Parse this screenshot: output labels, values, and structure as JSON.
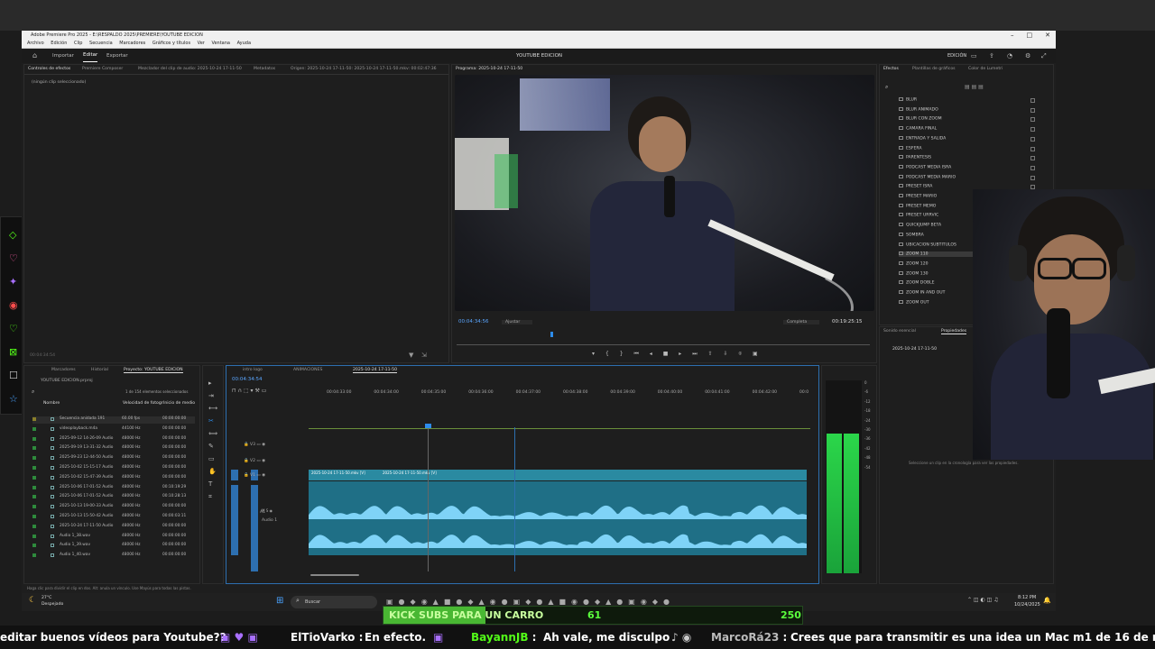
{
  "app": {
    "title": "Adobe Premiere Pro 2025 - E:\\RESPALDO 2025\\PREMIERE\\YOUTUBE EDICION",
    "menus": [
      "Archivo",
      "Edición",
      "Clip",
      "Secuencia",
      "Marcadores",
      "Gráficos y títulos",
      "Ver",
      "Ventana",
      "Ayuda"
    ],
    "workspace_tabs": [
      "Importar",
      "Editar",
      "Exportar"
    ],
    "active_tab": "Editar",
    "project_name": "YOUTUBE EDICION",
    "edition_label": "EDICIÓN"
  },
  "source_panel": {
    "tabs": [
      "Controles de efectos",
      "Premiere Composer",
      "Mezclador del clip de audio: 2025-10-24 17-11-50",
      "Metadatos",
      "Origen: 2025-10-24 17-11-50: 2025-10-24 17-11-50.mkv: 00:02:47:36"
    ],
    "message": "(ningún clip seleccionado)",
    "bottom_tc": "00:04:34:54"
  },
  "program_monitor": {
    "tab": "Programa: 2025-10-24 17-11-50",
    "timecode": "00:04:34:56",
    "fit": "Ajustar",
    "quality": "Completa",
    "duration": "00:19:25:15"
  },
  "effects_panel": {
    "tabs": [
      "Efectos",
      "Plantillas de gráficos",
      "Color de Lumetri"
    ],
    "items": [
      "BLUR",
      "BLUR ANIMADO",
      "BLUR CON ZOOM",
      "CAMARA FINAL",
      "ENTRADA Y SALIDA",
      "ESFERA",
      "PARENTESIS",
      "PODCAST MEDIA ISRA",
      "PODCAST MEDIA MARIO",
      "PRESET ISRA",
      "PRESET MARIO",
      "PRESET MEMO",
      "PRESET URRVIC",
      "QUICKJUMP BETA",
      "SOMBRA",
      "UBICACION SUBTITULOS",
      "ZOOM 110",
      "ZOOM 120",
      "ZOOM 130",
      "ZOOM DOBLE",
      "ZOOM IN AND OUT",
      "ZOOM OUT"
    ],
    "selected": "ZOOM 110"
  },
  "props_panel": {
    "tabs": [
      "Sonido esencial",
      "Propiedades"
    ],
    "clip": "2025-10-24 17-11-50",
    "hint": "Seleccione un clip en la cronología para ver las propiedades."
  },
  "project_panel": {
    "tabs": [
      "Marcadores",
      "Historial",
      "Proyecto: YOUTUBE EDICION"
    ],
    "file": "YOUTUBE EDICION.prproj",
    "count": "1 de 154 elementos seleccionados",
    "columns": [
      "Nombre",
      "Velocidad de fotogr",
      "Inicio de medio"
    ],
    "rows": [
      {
        "name": "Secuencia anidada 191",
        "fps": "60.00 fps",
        "start": "00:00:00:00",
        "color": "#8a7f2a"
      },
      {
        "name": "videoplayback.m4a",
        "fps": "44100 Hz",
        "start": "00:00:00:00",
        "color": "#2e8a3c"
      },
      {
        "name": "2025-09-12 14-26-09 Audio",
        "fps": "48000 Hz",
        "start": "00:00:00:00",
        "color": "#2e8a3c"
      },
      {
        "name": "2025-09-19 13-31-32 Audio",
        "fps": "48000 Hz",
        "start": "00:00:00:00",
        "color": "#2e8a3c"
      },
      {
        "name": "2025-09-23 12-44-50 Audio",
        "fps": "48000 Hz",
        "start": "00:00:00:00",
        "color": "#2e8a3c"
      },
      {
        "name": "2025-10-02 15-15-17 Audio",
        "fps": "48000 Hz",
        "start": "00:00:00:00",
        "color": "#2e8a3c"
      },
      {
        "name": "2025-10-02 15-47-39 Audio",
        "fps": "48000 Hz",
        "start": "00:00:00:00",
        "color": "#2e8a3c"
      },
      {
        "name": "2025-10-06 17-01-52 Audio",
        "fps": "48000 Hz",
        "start": "00:10:19:29",
        "color": "#2e8a3c"
      },
      {
        "name": "2025-10-06 17-01-52 Audio",
        "fps": "48000 Hz",
        "start": "00:10:28:13",
        "color": "#2e8a3c"
      },
      {
        "name": "2025-10-13 19-00-33 Audio",
        "fps": "48000 Hz",
        "start": "00:00:00:00",
        "color": "#2e8a3c"
      },
      {
        "name": "2025-10-13 15-50-42 Audio",
        "fps": "48000 Hz",
        "start": "00:00:03:11",
        "color": "#2e8a3c"
      },
      {
        "name": "2025-10-24 17-11-50 Audio",
        "fps": "48000 Hz",
        "start": "00:00:00:00",
        "color": "#2e8a3c"
      },
      {
        "name": "Audio 1_38.wav",
        "fps": "48000 Hz",
        "start": "00:00:00:00",
        "color": "#2e8a3c"
      },
      {
        "name": "Audio 1_39.wav",
        "fps": "48000 Hz",
        "start": "00:00:00:00",
        "color": "#2e8a3c"
      },
      {
        "name": "Audio 1_40.wav",
        "fps": "48000 Hz",
        "start": "00:00:00:00",
        "color": "#2e8a3c"
      }
    ]
  },
  "timeline": {
    "tabs": [
      "intro logo",
      "ANIMACIONES",
      "2025-10-24 17-11-50"
    ],
    "timecode": "00:04:34:54",
    "ruler": [
      "00:04:33:00",
      "00:04:34:00",
      "00:04:35:00",
      "00:04:36:00",
      "00:04:37:00",
      "00:04:38:00",
      "00:04:39:00",
      "00:04:40:00",
      "00:04:41:00",
      "00:04:42:00",
      "00:0"
    ],
    "video_tracks": [
      "V3",
      "V2",
      "V1"
    ],
    "audio_tracks": [
      "A1"
    ],
    "audio_track_name": "Audio 1",
    "clip_label_a": "2025-10-24 17-11-50.mkv [V]",
    "clip_label_b": "2025-10-24 17-11-50.mkv [V]"
  },
  "meter_scale": [
    "0",
    "-6",
    "-12",
    "-18",
    "-24",
    "-30",
    "-36",
    "-42",
    "-48",
    "-54"
  ],
  "status_hint": "Haga clic para dividir el clip en dos. Alt: anula un vínculo. Use Mayús para todas las pistas.",
  "taskbar": {
    "weather_temp": "27°C",
    "weather_desc": "Despejado",
    "search": "Buscar",
    "time": "8:12 PM",
    "date": "10/24/2025"
  },
  "kick_goal": {
    "label": "KICK SUBS PARA UN CARRO",
    "current": "61",
    "target": "250",
    "progress": 0.244,
    "color": "#53fc18"
  },
  "chat": [
    {
      "user": "",
      "text": "editar buenos vídeos para Youtube??",
      "color": "#ffffff"
    },
    {
      "user": "ElTioVarko",
      "text": "En efecto.",
      "color": "#ffffff"
    },
    {
      "user": "BayannJB",
      "text": "Ah vale, me disculpo",
      "color": "#53fc18"
    },
    {
      "user": "MarcoRá23",
      "text": "Crees que para transmitir es una idea un Mac m1 de 16 de ram ?",
      "color": "#bbbbbb"
    }
  ],
  "accent": "#2d8ceb",
  "clip_color": "#2a8aa1",
  "wave_color": "#7fd3f7"
}
